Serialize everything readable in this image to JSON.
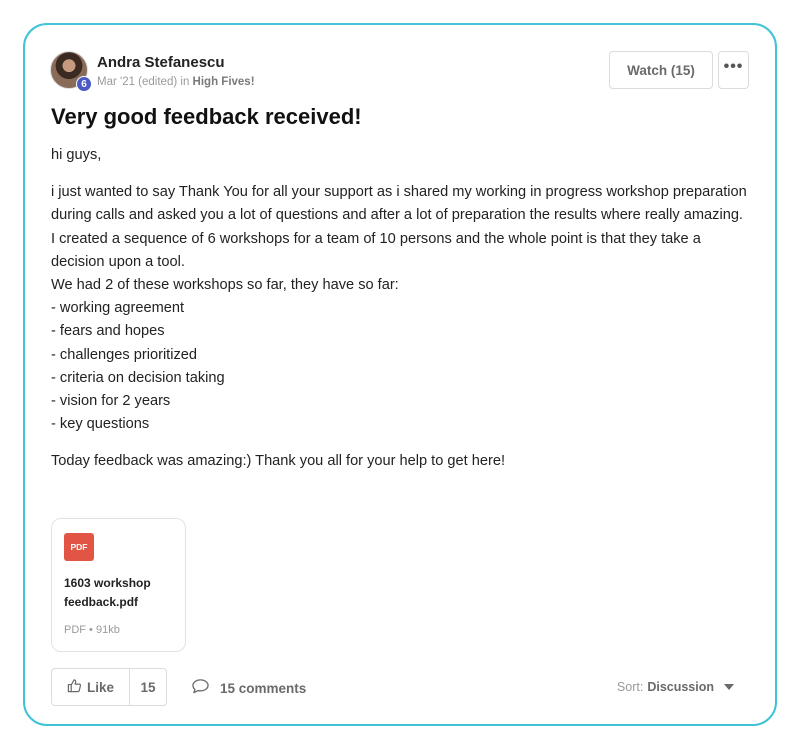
{
  "post": {
    "author": "Andra Stefanescu",
    "rank": "6",
    "date": "Mar '21 (edited)",
    "in_label": "in",
    "category": "High Fives!",
    "watch_label": "Watch (15)",
    "more_label": "•••",
    "title": "Very good feedback received!",
    "greeting": "hi guys,",
    "body_lines": [
      "i just wanted to say Thank You for all your support as i shared my working in progress workshop preparation during calls and asked you a lot of questions and after a lot of preparation the results where really amazing.",
      "I created a sequence of 6 workshops for a team of 10 persons and the whole point is that they take a decision upon a tool.",
      "We had 2 of these workshops so far, they have so far:",
      "- working agreement",
      "- fears and hopes",
      "- challenges prioritized",
      "- criteria on decision taking",
      "- vision for 2 years",
      "- key questions"
    ],
    "closing": "Today feedback was amazing:) Thank you all for your help to get here!"
  },
  "attachment": {
    "type_label": "PDF",
    "file_name": "1603 workshop feedback.pdf",
    "file_meta": "PDF • 91kb"
  },
  "footer": {
    "like_label": "Like",
    "like_count": "15",
    "comments_label": "15 comments",
    "sort_label": "Sort:",
    "sort_value": "Discussion"
  },
  "colors": {
    "card_border": "#3fc3d6",
    "rank_badge": "#4a5bc4",
    "pdf_icon": "#e25545"
  }
}
